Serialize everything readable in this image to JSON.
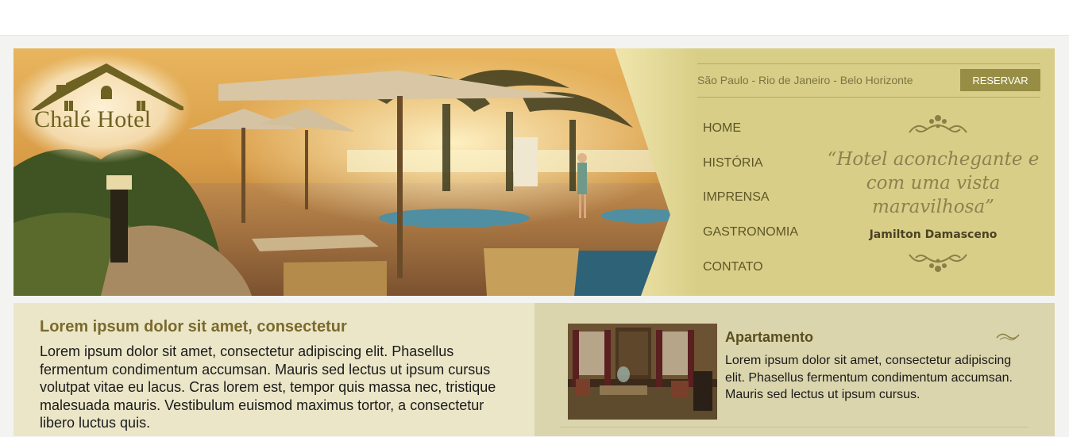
{
  "header": {
    "logo_text": "Chalé Hotel",
    "cities": "São Paulo - Rio de Janeiro - Belo Horizonte",
    "reserve_label": "RESERVAR",
    "nav": [
      {
        "label": "HOME"
      },
      {
        "label": "HISTÓRIA"
      },
      {
        "label": "IMPRENSA"
      },
      {
        "label": "GASTRONOMIA"
      },
      {
        "label": "CONTATO"
      }
    ],
    "quote": "“Hotel aconchegante e com uma vista maravilhosa”",
    "quote_author": "Jamilton Damasceno"
  },
  "intro": {
    "title": "Lorem ipsum dolor sit amet, consectetur",
    "body": "Lorem ipsum dolor sit amet, consectetur adipiscing elit. Phasellus fermentum condimentum accumsan. Mauris sed lectus ut ipsum cursus volutpat vitae eu lacus. Cras lorem est, tempor quis massa nec, tristique malesuada mauris. Vestibulum euismod maximus tortor, a consectetur libero luctus quis."
  },
  "apartment": {
    "title": "Apartamento",
    "body": "Lorem ipsum dolor sit amet, consectetur adipiscing elit. Phasellus fermentum condimentum accumsan. Mauris sed lectus ut ipsum cursus."
  },
  "colors": {
    "accent": "#978d45",
    "panel": "#d9ce87",
    "heading": "#7a6a2c",
    "intro_bg": "#ebe6c8",
    "apartment_bg": "#dbd5ae"
  }
}
